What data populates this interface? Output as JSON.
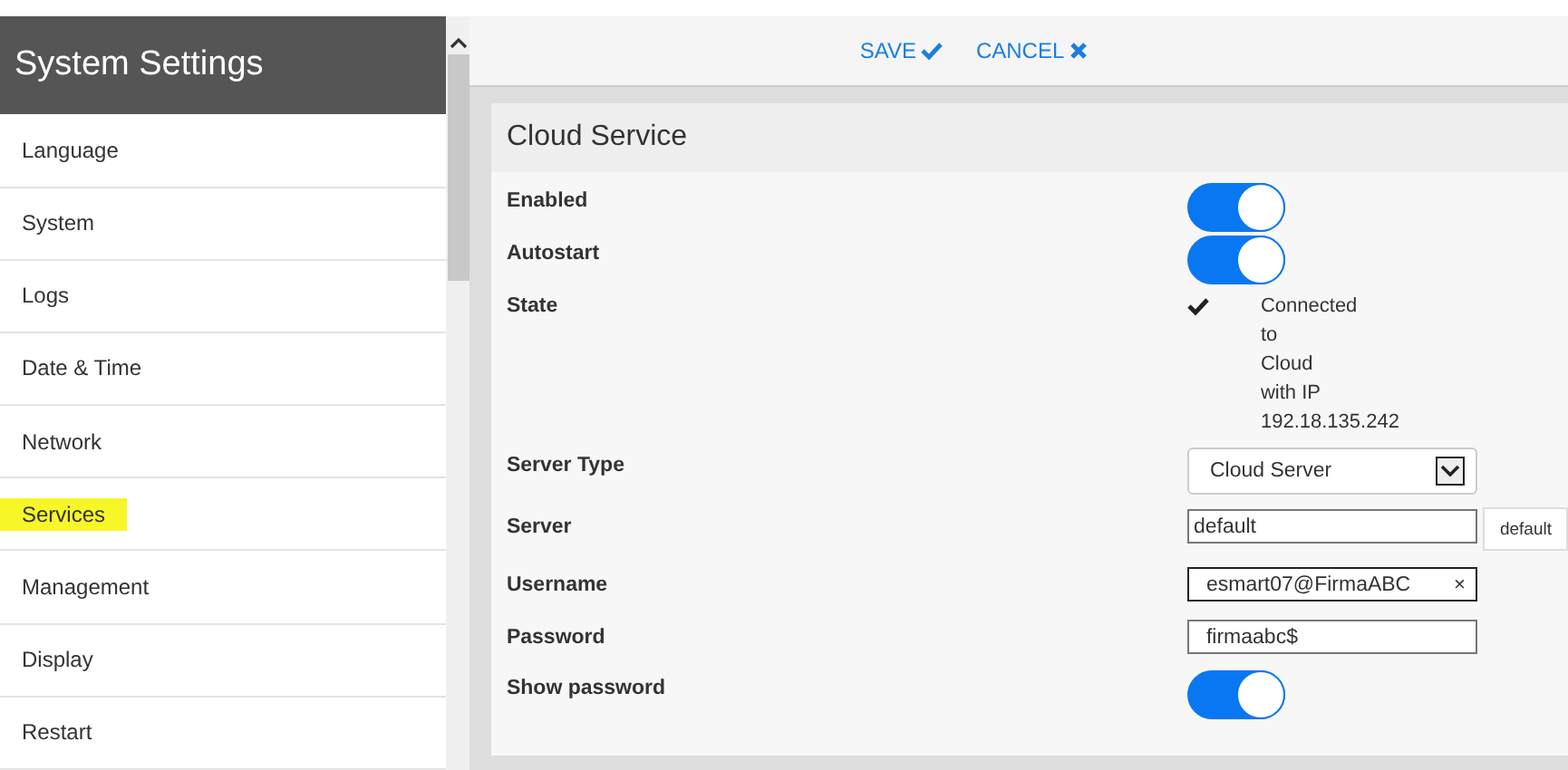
{
  "sidebar": {
    "title": "System Settings",
    "items": [
      {
        "label": "Language",
        "selected": false
      },
      {
        "label": "System",
        "selected": false
      },
      {
        "label": "Logs",
        "selected": false
      },
      {
        "label": "Date & Time",
        "selected": false
      },
      {
        "label": "Network",
        "selected": false
      },
      {
        "label": "Services",
        "selected": true
      },
      {
        "label": "Management",
        "selected": false
      },
      {
        "label": "Display",
        "selected": false
      },
      {
        "label": "Restart",
        "selected": false
      }
    ]
  },
  "toolbar": {
    "save": "SAVE",
    "cancel": "CANCEL"
  },
  "panel": {
    "title": "Cloud Service",
    "rows": [
      {
        "kind": "toggle",
        "label": "Enabled",
        "on": true
      },
      {
        "kind": "toggle",
        "label": "Autostart",
        "on": true
      },
      {
        "kind": "status",
        "label": "State",
        "lines": [
          "Connected",
          "to",
          "Cloud",
          "with IP",
          "192.18.135.242"
        ]
      },
      {
        "kind": "select",
        "label": "Server Type",
        "value": "Cloud Server"
      },
      {
        "kind": "input-button",
        "label": "Server",
        "value": "default",
        "button": "default"
      },
      {
        "kind": "input-clear",
        "label": "Username",
        "value": "esmart07@FirmaABC",
        "clear": "×"
      },
      {
        "kind": "input",
        "label": "Password",
        "value": "firmaabc$"
      },
      {
        "kind": "toggle",
        "label": "Show password",
        "on": true
      }
    ]
  }
}
